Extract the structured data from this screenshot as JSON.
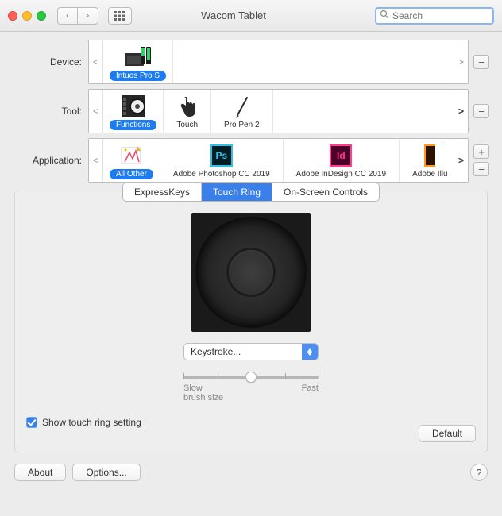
{
  "window": {
    "title": "Wacom Tablet"
  },
  "search": {
    "placeholder": "Search"
  },
  "rows": {
    "device": {
      "label": "Device:",
      "items": [
        {
          "label": "Intuos Pro S"
        }
      ]
    },
    "tool": {
      "label": "Tool:",
      "items": [
        {
          "label": "Functions"
        },
        {
          "label": "Touch"
        },
        {
          "label": "Pro Pen 2"
        }
      ]
    },
    "application": {
      "label": "Application:",
      "items": [
        {
          "label": "All Other"
        },
        {
          "label": "Adobe Photoshop CC 2019"
        },
        {
          "label": "Adobe InDesign CC 2019"
        },
        {
          "label": "Adobe Illu"
        }
      ]
    }
  },
  "tabs": [
    {
      "label": "ExpressKeys"
    },
    {
      "label": "Touch Ring"
    },
    {
      "label": "On-Screen Controls"
    }
  ],
  "panel": {
    "action_select": "Keystroke...",
    "slider_min_label": "Slow",
    "slider_max_label": "Fast",
    "slider_sub_label": "brush size",
    "checkbox_label": "Show touch ring setting",
    "default_button": "Default"
  },
  "footer": {
    "about": "About",
    "options": "Options...",
    "help": "?"
  },
  "glyphs": {
    "plus": "+",
    "minus": "−",
    "left": "‹",
    "right": "›",
    "lt": "<",
    "gt": ">"
  }
}
